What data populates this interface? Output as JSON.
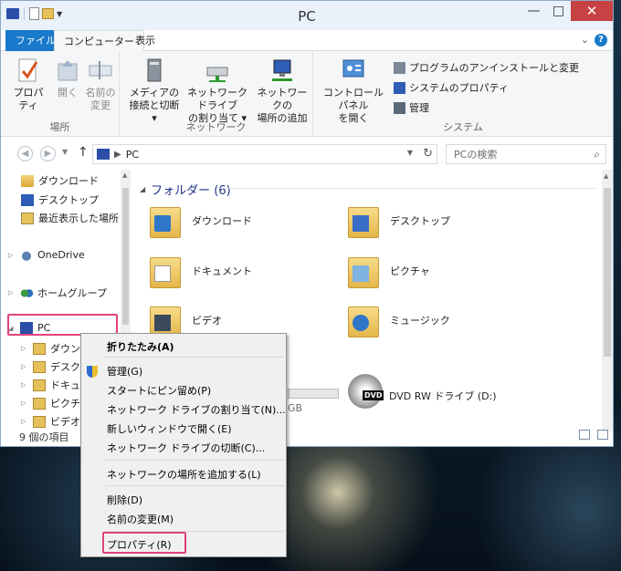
{
  "window": {
    "title": "PC",
    "minimize": "—",
    "maximize": "□",
    "close": "✕"
  },
  "ribbon_tabs": {
    "file": "ファイル",
    "computer": "コンピューター",
    "view": "表示"
  },
  "ribbon": {
    "location": {
      "label": "場所",
      "properties": "プロパティ",
      "open": "開く",
      "rename_1": "名前の",
      "rename_2": "変更"
    },
    "network": {
      "label": "ネットワーク",
      "media_1": "メディアの",
      "media_2": "接続と切断",
      "map_1": "ネットワーク ドライブ",
      "map_2": "の割り当て",
      "add_1": "ネットワークの",
      "add_2": "場所の追加"
    },
    "system": {
      "label": "システム",
      "control_1": "コントロール パネル",
      "control_2": "を開く",
      "uninstall": "プログラムのアンインストールと変更",
      "sysprops": "システムのプロパティ",
      "manage": "管理"
    }
  },
  "address": {
    "path": "PC",
    "search_placeholder": "PCの検索"
  },
  "nav": {
    "items": [
      {
        "label": "ダウンロード"
      },
      {
        "label": "デスクトップ"
      },
      {
        "label": "最近表示した場所"
      },
      {
        "label": "OneDrive"
      },
      {
        "label": "ホームグループ"
      },
      {
        "label": "PC"
      },
      {
        "label": "ダウンロー"
      },
      {
        "label": "デスクトッ"
      },
      {
        "label": "ドキュメン"
      },
      {
        "label": "ピクチャ"
      },
      {
        "label": "ビデオ"
      }
    ]
  },
  "content": {
    "group_header": "フォルダー (6)",
    "folders": [
      {
        "label": "ダウンロード",
        "icon": "downloads-folder-icon"
      },
      {
        "label": "デスクトップ",
        "icon": "desktop-folder-icon"
      },
      {
        "label": "ドキュメント",
        "icon": "documents-folder-icon"
      },
      {
        "label": "ピクチャ",
        "icon": "pictures-folder-icon"
      },
      {
        "label": "ビデオ",
        "icon": "videos-folder-icon"
      },
      {
        "label": "ミュージック",
        "icon": "music-folder-icon"
      }
    ],
    "drive_label": "DVD RW ドライブ (D:)",
    "c_drive_size": "GB"
  },
  "status": {
    "item_count": "9 個の項目"
  },
  "context_menu": {
    "items": [
      "折りたたみ(A)",
      "管理(G)",
      "スタートにピン留め(P)",
      "ネットワーク ドライブの割り当て(N)...",
      "新しいウィンドウで開く(E)",
      "ネットワーク ドライブの切断(C)...",
      "ネットワークの場所を追加する(L)",
      "削除(D)",
      "名前の変更(M)",
      "プロパティ(R)"
    ]
  },
  "colors": {
    "accent": "#1979ca",
    "highlight": "#e0437d",
    "close": "#c74242"
  }
}
